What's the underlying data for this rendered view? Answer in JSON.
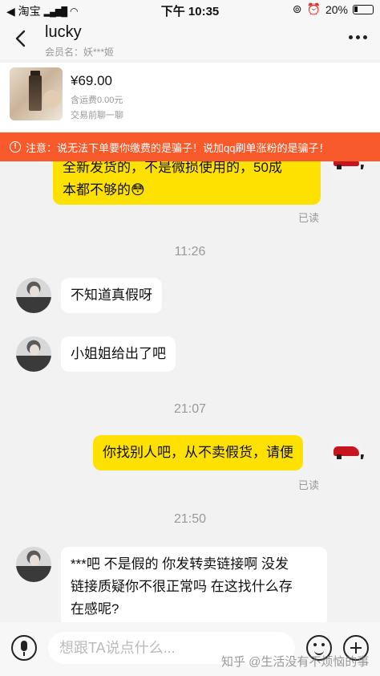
{
  "status_bar": {
    "carrier": "◀ 淘宝",
    "time": "下午 10:35",
    "battery": "20%"
  },
  "header": {
    "title": "lucky",
    "member_label": "会员名：妖***姬"
  },
  "product": {
    "price": "¥69.00",
    "shipping": "含运费0.00元",
    "hint": "交易前聊一聊"
  },
  "warning": {
    "text": "注意：说无法下单要你缴费的是骗子！说加qq刷单涨粉的是骗子！"
  },
  "messages": [
    {
      "type": "mine",
      "lines": [
        "全新发货的，不是微损使用的，50成",
        "本都不够的😳"
      ],
      "read": "已读"
    },
    {
      "type": "time",
      "text": "11:26"
    },
    {
      "type": "theirs",
      "text": "不知道真假呀"
    },
    {
      "type": "theirs",
      "text": "小姐姐给出了吧"
    },
    {
      "type": "time",
      "text": "21:07"
    },
    {
      "type": "mine",
      "text": "你找别人吧，从不卖假货，请便",
      "read": "已读"
    },
    {
      "type": "time",
      "text": "21:50"
    },
    {
      "type": "theirs",
      "lines": [
        "***吧 不是假的 你发转卖链接啊 没发",
        "链接质疑你不很正常吗 在这找什么存",
        "在感呢?"
      ]
    }
  ],
  "input": {
    "placeholder": "想跟TA说点什么..."
  },
  "watermark": "知乎 @生活没有不烦恼的事"
}
